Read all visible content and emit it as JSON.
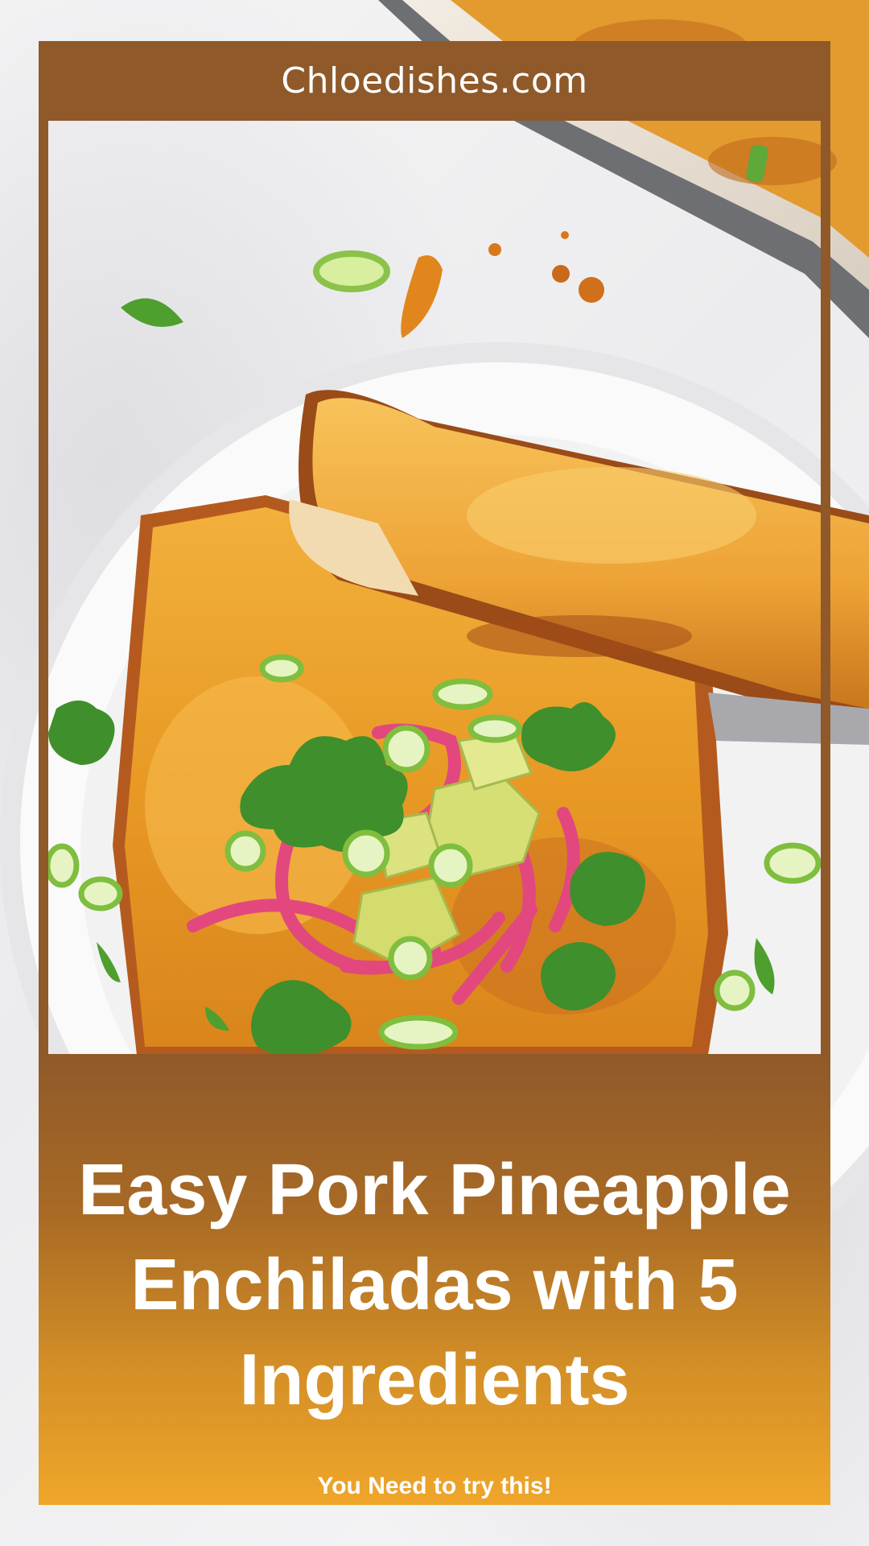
{
  "header": {
    "site_name": "Chloedishes.com"
  },
  "pin": {
    "title": "Easy Pork Pineapple Enchiladas with 5 Ingredients",
    "tagline": "You Need to try this!"
  },
  "colors": {
    "frame_brown": "#8f5929",
    "panel_gradient_top": "#8f5929",
    "panel_gradient_bottom": "#efa62a",
    "text": "#ffffff"
  }
}
